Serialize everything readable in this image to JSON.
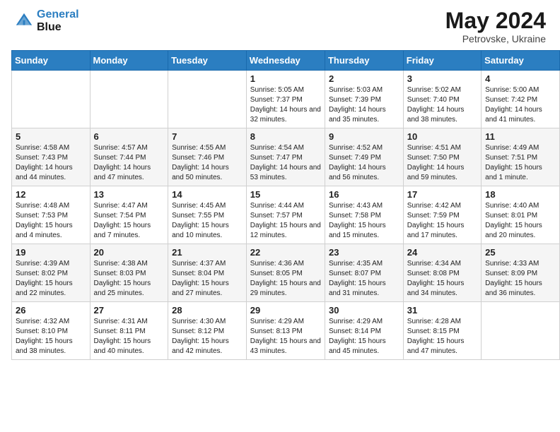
{
  "header": {
    "logo_line1": "General",
    "logo_line2": "Blue",
    "title": "May 2024",
    "subtitle": "Petrovske, Ukraine"
  },
  "days_of_week": [
    "Sunday",
    "Monday",
    "Tuesday",
    "Wednesday",
    "Thursday",
    "Friday",
    "Saturday"
  ],
  "weeks": [
    [
      {
        "day": "",
        "sunrise": "",
        "sunset": "",
        "daylight": ""
      },
      {
        "day": "",
        "sunrise": "",
        "sunset": "",
        "daylight": ""
      },
      {
        "day": "",
        "sunrise": "",
        "sunset": "",
        "daylight": ""
      },
      {
        "day": "1",
        "sunrise": "Sunrise: 5:05 AM",
        "sunset": "Sunset: 7:37 PM",
        "daylight": "Daylight: 14 hours and 32 minutes."
      },
      {
        "day": "2",
        "sunrise": "Sunrise: 5:03 AM",
        "sunset": "Sunset: 7:39 PM",
        "daylight": "Daylight: 14 hours and 35 minutes."
      },
      {
        "day": "3",
        "sunrise": "Sunrise: 5:02 AM",
        "sunset": "Sunset: 7:40 PM",
        "daylight": "Daylight: 14 hours and 38 minutes."
      },
      {
        "day": "4",
        "sunrise": "Sunrise: 5:00 AM",
        "sunset": "Sunset: 7:42 PM",
        "daylight": "Daylight: 14 hours and 41 minutes."
      }
    ],
    [
      {
        "day": "5",
        "sunrise": "Sunrise: 4:58 AM",
        "sunset": "Sunset: 7:43 PM",
        "daylight": "Daylight: 14 hours and 44 minutes."
      },
      {
        "day": "6",
        "sunrise": "Sunrise: 4:57 AM",
        "sunset": "Sunset: 7:44 PM",
        "daylight": "Daylight: 14 hours and 47 minutes."
      },
      {
        "day": "7",
        "sunrise": "Sunrise: 4:55 AM",
        "sunset": "Sunset: 7:46 PM",
        "daylight": "Daylight: 14 hours and 50 minutes."
      },
      {
        "day": "8",
        "sunrise": "Sunrise: 4:54 AM",
        "sunset": "Sunset: 7:47 PM",
        "daylight": "Daylight: 14 hours and 53 minutes."
      },
      {
        "day": "9",
        "sunrise": "Sunrise: 4:52 AM",
        "sunset": "Sunset: 7:49 PM",
        "daylight": "Daylight: 14 hours and 56 minutes."
      },
      {
        "day": "10",
        "sunrise": "Sunrise: 4:51 AM",
        "sunset": "Sunset: 7:50 PM",
        "daylight": "Daylight: 14 hours and 59 minutes."
      },
      {
        "day": "11",
        "sunrise": "Sunrise: 4:49 AM",
        "sunset": "Sunset: 7:51 PM",
        "daylight": "Daylight: 15 hours and 1 minute."
      }
    ],
    [
      {
        "day": "12",
        "sunrise": "Sunrise: 4:48 AM",
        "sunset": "Sunset: 7:53 PM",
        "daylight": "Daylight: 15 hours and 4 minutes."
      },
      {
        "day": "13",
        "sunrise": "Sunrise: 4:47 AM",
        "sunset": "Sunset: 7:54 PM",
        "daylight": "Daylight: 15 hours and 7 minutes."
      },
      {
        "day": "14",
        "sunrise": "Sunrise: 4:45 AM",
        "sunset": "Sunset: 7:55 PM",
        "daylight": "Daylight: 15 hours and 10 minutes."
      },
      {
        "day": "15",
        "sunrise": "Sunrise: 4:44 AM",
        "sunset": "Sunset: 7:57 PM",
        "daylight": "Daylight: 15 hours and 12 minutes."
      },
      {
        "day": "16",
        "sunrise": "Sunrise: 4:43 AM",
        "sunset": "Sunset: 7:58 PM",
        "daylight": "Daylight: 15 hours and 15 minutes."
      },
      {
        "day": "17",
        "sunrise": "Sunrise: 4:42 AM",
        "sunset": "Sunset: 7:59 PM",
        "daylight": "Daylight: 15 hours and 17 minutes."
      },
      {
        "day": "18",
        "sunrise": "Sunrise: 4:40 AM",
        "sunset": "Sunset: 8:01 PM",
        "daylight": "Daylight: 15 hours and 20 minutes."
      }
    ],
    [
      {
        "day": "19",
        "sunrise": "Sunrise: 4:39 AM",
        "sunset": "Sunset: 8:02 PM",
        "daylight": "Daylight: 15 hours and 22 minutes."
      },
      {
        "day": "20",
        "sunrise": "Sunrise: 4:38 AM",
        "sunset": "Sunset: 8:03 PM",
        "daylight": "Daylight: 15 hours and 25 minutes."
      },
      {
        "day": "21",
        "sunrise": "Sunrise: 4:37 AM",
        "sunset": "Sunset: 8:04 PM",
        "daylight": "Daylight: 15 hours and 27 minutes."
      },
      {
        "day": "22",
        "sunrise": "Sunrise: 4:36 AM",
        "sunset": "Sunset: 8:05 PM",
        "daylight": "Daylight: 15 hours and 29 minutes."
      },
      {
        "day": "23",
        "sunrise": "Sunrise: 4:35 AM",
        "sunset": "Sunset: 8:07 PM",
        "daylight": "Daylight: 15 hours and 31 minutes."
      },
      {
        "day": "24",
        "sunrise": "Sunrise: 4:34 AM",
        "sunset": "Sunset: 8:08 PM",
        "daylight": "Daylight: 15 hours and 34 minutes."
      },
      {
        "day": "25",
        "sunrise": "Sunrise: 4:33 AM",
        "sunset": "Sunset: 8:09 PM",
        "daylight": "Daylight: 15 hours and 36 minutes."
      }
    ],
    [
      {
        "day": "26",
        "sunrise": "Sunrise: 4:32 AM",
        "sunset": "Sunset: 8:10 PM",
        "daylight": "Daylight: 15 hours and 38 minutes."
      },
      {
        "day": "27",
        "sunrise": "Sunrise: 4:31 AM",
        "sunset": "Sunset: 8:11 PM",
        "daylight": "Daylight: 15 hours and 40 minutes."
      },
      {
        "day": "28",
        "sunrise": "Sunrise: 4:30 AM",
        "sunset": "Sunset: 8:12 PM",
        "daylight": "Daylight: 15 hours and 42 minutes."
      },
      {
        "day": "29",
        "sunrise": "Sunrise: 4:29 AM",
        "sunset": "Sunset: 8:13 PM",
        "daylight": "Daylight: 15 hours and 43 minutes."
      },
      {
        "day": "30",
        "sunrise": "Sunrise: 4:29 AM",
        "sunset": "Sunset: 8:14 PM",
        "daylight": "Daylight: 15 hours and 45 minutes."
      },
      {
        "day": "31",
        "sunrise": "Sunrise: 4:28 AM",
        "sunset": "Sunset: 8:15 PM",
        "daylight": "Daylight: 15 hours and 47 minutes."
      },
      {
        "day": "",
        "sunrise": "",
        "sunset": "",
        "daylight": ""
      }
    ]
  ]
}
